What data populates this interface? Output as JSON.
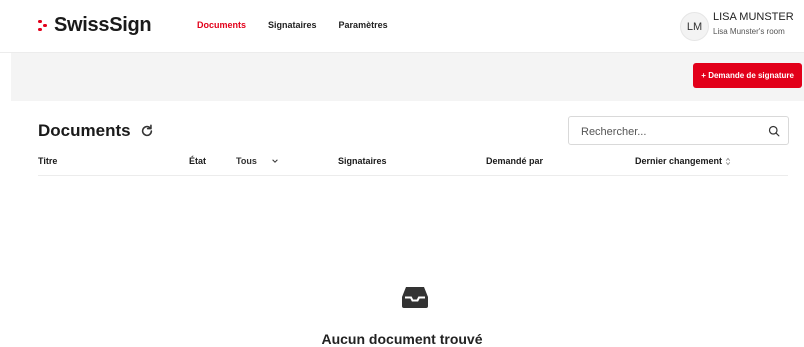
{
  "header": {
    "logo_text": "SwissSign",
    "nav": [
      "Documents",
      "Signataires",
      "Paramètres"
    ],
    "active_nav": "Documents",
    "user": {
      "initials": "LM",
      "name": "LISA MUNSTER",
      "room": "Lisa Munster's room"
    }
  },
  "toolbar": {
    "request_button": "+ Demande de signature"
  },
  "main": {
    "title": "Documents",
    "search": {
      "placeholder": "Rechercher...",
      "value": ""
    },
    "columns": {
      "title": "Titre",
      "state": "État",
      "state_filter": "Tous",
      "signers": "Signataires",
      "requested_by": "Demandé par",
      "last_change": "Dernier changement"
    },
    "rows": [],
    "empty_message": "Aucun document trouvé"
  },
  "colors": {
    "accent": "#e2001a",
    "toolbar_bg": "#f4f4f4"
  },
  "icons": [
    "refresh-icon",
    "search-icon",
    "chevron-down-icon",
    "sort-icon",
    "inbox-icon"
  ]
}
